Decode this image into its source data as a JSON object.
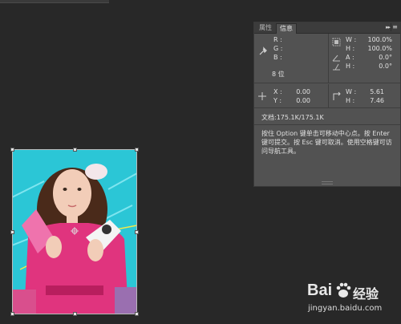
{
  "panel": {
    "tabs": [
      {
        "label": "属性",
        "active": false
      },
      {
        "label": "信息",
        "active": true
      }
    ],
    "collapse_glyph": "▸▸",
    "menu_glyph": "≡",
    "color": {
      "r_label": "R :",
      "g_label": "G :",
      "b_label": "B :",
      "bit_depth": "8 位",
      "w_label": "W :",
      "w_value": "100.0%",
      "h_label": "H :",
      "h_value": "100.0%",
      "a_label": "A :",
      "a_value": "0.0°",
      "h2_label": "H :",
      "h2_value": "0.0°"
    },
    "position": {
      "x_label": "X :",
      "x_value": "0.00",
      "y_label": "Y :",
      "y_value": "0.00",
      "w_label": "W :",
      "w_value": "5.61",
      "h_label": "H :",
      "h_value": "7.46"
    },
    "doc_info": "文档:175.1K/175.1K",
    "hint": "按住 Option 键单击可移动中心点。按 Enter 键可提交。按 Esc 键可取消。使用空格键可访问导航工具。",
    "icons": [
      "eyedropper-icon",
      "crosshair-icon",
      "transform-scale-icon",
      "angle-icon",
      "skew-icon",
      "selection-size-icon"
    ]
  },
  "watermark": {
    "brand": "Bai",
    "brand_suffix": "经验",
    "url": "jingyan.baidu.com",
    "icon": "baidu-paw-icon"
  },
  "colors": {
    "workspace": "#282828",
    "panel": "#525252",
    "canvas_bg": "#2bc6d6",
    "dress": "#e0347e"
  }
}
